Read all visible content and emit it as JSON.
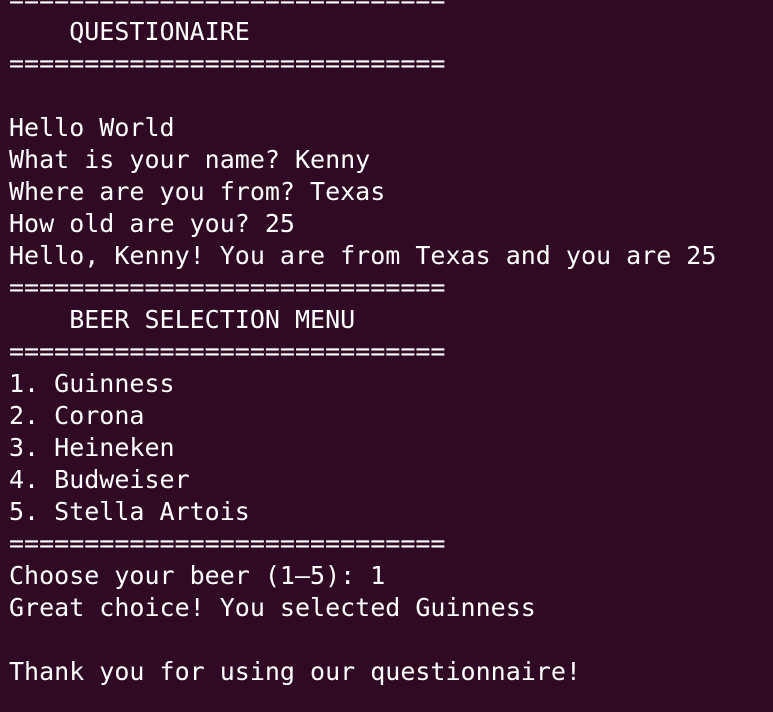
{
  "terminal": {
    "background": "#300a24",
    "foreground": "#ffffff",
    "lines": [
      "=============================",
      "    QUESTIONAIRE",
      "=============================",
      "",
      "Hello World",
      "What is your name? Kenny",
      "Where are you from? Texas",
      "How old are you? 25",
      "Hello, Kenny! You are from Texas and you are 25",
      "=============================",
      "    BEER SELECTION MENU",
      "=============================",
      "1. Guinness",
      "2. Corona",
      "3. Heineken",
      "4. Budweiser",
      "5. Stella Artois",
      "=============================",
      "Choose your beer (1–5): 1",
      "Great choice! You selected Guinness",
      "",
      "Thank you for using our questionnaire!"
    ]
  }
}
